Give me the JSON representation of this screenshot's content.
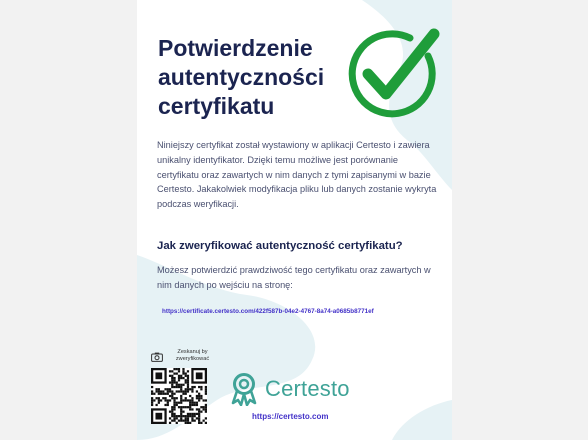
{
  "title": "Potwierdzenie autentyczności certyfikatu",
  "intro": "Niniejszy certyfikat został wystawiony w aplikacji Certesto i zawiera unikalny identyfikator. Dzięki temu możliwe jest porównanie certyfikatu oraz zawartych w nim danych z tymi zapisanymi w bazie Certesto. Jakakolwiek modyfikacja pliku lub danych zostanie wykryta podczas weryfikacji.",
  "question": "Jak zweryfikować autentyczność certyfikatu?",
  "howto": "Możesz potwierdzić prawdziwość tego certyfikatu oraz zawartych w nim danych po wejściu na stronę:",
  "certificate_url": "https://certificate.certesto.com/422f587b-04e2-4767-8a74-a0685b8771ef",
  "scan": {
    "label_line1": "Zeskanuj by",
    "label_line2": "zweryfikować"
  },
  "brand": {
    "name": "Certesto",
    "url": "https://certesto.com"
  },
  "icons": {
    "check": "check-circle-icon",
    "camera": "camera-icon",
    "brand_logo": "award-ribbon-icon"
  },
  "colors": {
    "title": "#1b2450",
    "check": "#1f9d3a",
    "link": "#4332c8",
    "brand": "#3fa397",
    "blob": "#e3f0f4"
  }
}
